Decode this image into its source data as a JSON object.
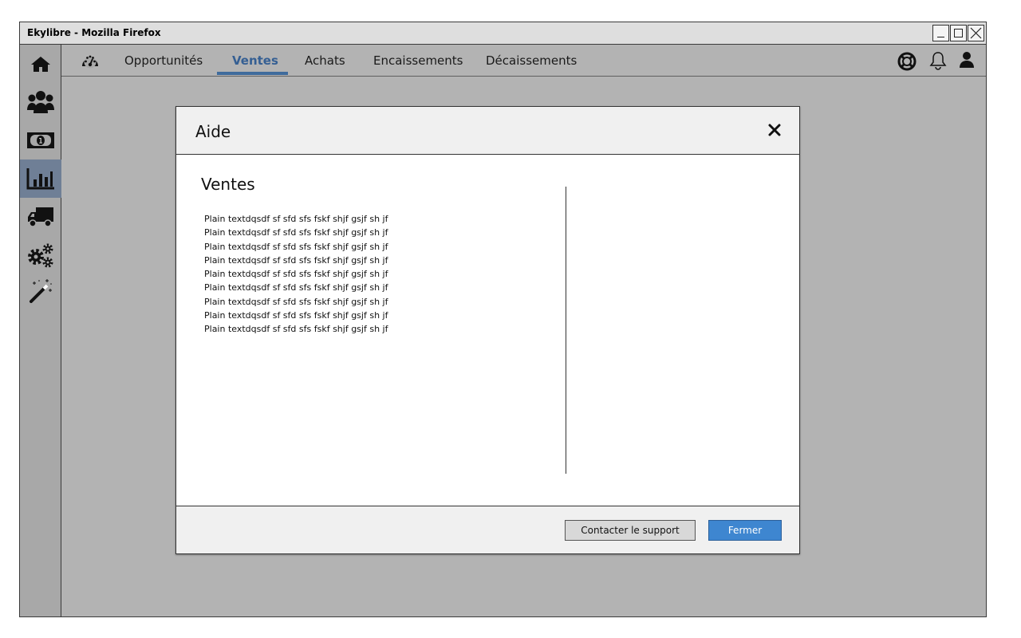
{
  "window": {
    "title": "Ekylibre - Mozilla Firefox"
  },
  "sidebar": {
    "items": [
      {
        "icon": "home-icon"
      },
      {
        "icon": "users-icon"
      },
      {
        "icon": "money-icon"
      },
      {
        "icon": "bar-chart-icon",
        "active": true
      },
      {
        "icon": "truck-icon"
      },
      {
        "icon": "cogs-icon"
      },
      {
        "icon": "magic-wand-icon"
      }
    ]
  },
  "nav": {
    "tabs": [
      {
        "label": "Opportunités"
      },
      {
        "label": "Ventes",
        "active": true
      },
      {
        "label": "Achats"
      },
      {
        "label": "Encaissements"
      },
      {
        "label": "Décaissements"
      }
    ],
    "right_icons": [
      "lifebuoy-icon",
      "bell-icon",
      "user-icon"
    ]
  },
  "modal": {
    "title": "Aide",
    "section_title": "Ventes",
    "lines": [
      "Plain textdqsdf sf sfd sfs fskf shjf gsjf sh jf",
      "Plain textdqsdf sf sfd sfs fskf shjf gsjf sh jf",
      "Plain textdqsdf sf sfd sfs fskf shjf gsjf sh jf",
      "Plain textdqsdf sf sfd sfs fskf shjf gsjf sh jf",
      "Plain textdqsdf sf sfd sfs fskf shjf gsjf sh jf",
      "Plain textdqsdf sf sfd sfs fskf shjf gsjf sh jf",
      "Plain textdqsdf sf sfd sfs fskf shjf gsjf sh jf",
      "Plain textdqsdf sf sfd sfs fskf shjf gsjf sh jf",
      "Plain textdqsdf sf sfd sfs fskf shjf gsjf sh jf"
    ],
    "footer": {
      "support_label": "Contacter le support",
      "close_label": "Fermer"
    }
  },
  "colors": {
    "accent": "#3e86d0",
    "nav_active": "#355f93",
    "sidebar_active": "#6f7f96",
    "backdrop": "#b3b3b3"
  }
}
